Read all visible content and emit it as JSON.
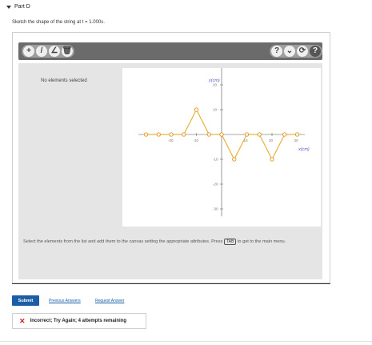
{
  "part": {
    "title": "Part D"
  },
  "prompt": {
    "text": "Sketch the shape of the string at t = 1.000s."
  },
  "toolbar": {
    "left_tools": [
      "+",
      "/",
      "∠",
      "🗑"
    ],
    "right_tools": [
      "?",
      "⌄",
      "⟳",
      "?"
    ]
  },
  "panel": {
    "empty_note": "No elements selected"
  },
  "graph": {
    "x_label": "x(cm)",
    "y_label": "y(cm)",
    "x_ticks": [
      "-10",
      "-20",
      "10",
      "20",
      "30"
    ],
    "y_ticks": [
      "30",
      "20",
      "10",
      "-10",
      "-20",
      "-30"
    ],
    "line_color": "#e6b33a",
    "points": [
      [
        -30,
        0
      ],
      [
        -25,
        0
      ],
      [
        -20,
        0
      ],
      [
        -15,
        0
      ],
      [
        -10,
        10
      ],
      [
        -5,
        0
      ],
      [
        0,
        0
      ],
      [
        5,
        -10
      ],
      [
        10,
        0
      ],
      [
        15,
        0
      ],
      [
        20,
        -10
      ],
      [
        25,
        0
      ],
      [
        30,
        0
      ]
    ]
  },
  "instructions": {
    "before": "Select the elements from the list and add them to the canvas setting the appropriate attributes. Press",
    "key": "TAB",
    "after": "to get to the main menu."
  },
  "actions": {
    "submit": "Submit",
    "previous": "Previous Answers",
    "request": "Request Answer"
  },
  "feedback": {
    "icon": "✕",
    "message": "Incorrect; Try Again; 4 attempts remaining"
  }
}
